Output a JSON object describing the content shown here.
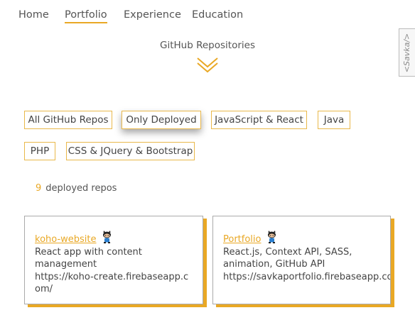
{
  "nav": {
    "items": [
      "Home",
      "Portfolio",
      "Experience",
      "Education"
    ],
    "active": "Portfolio"
  },
  "side_tab": {
    "label": "<Savka/>"
  },
  "section": {
    "title": "GitHub Repositories",
    "chevron_icon": "double-chevron-down-icon"
  },
  "filters": {
    "items": [
      "All GitHub Repos",
      "Only Deployed",
      "JavaScript & React",
      "Java",
      "PHP",
      "CSS & JQuery & Bootstrap"
    ],
    "active": "Only Deployed"
  },
  "repo_count": {
    "number": "9",
    "label": "deployed repos"
  },
  "repos": [
    {
      "name": "koho-website",
      "description": "React app with content management",
      "url": "https://koho-create.firebaseapp.com/",
      "icon": "octocat-icon"
    },
    {
      "name": "Portfolio",
      "description": "React.js, Context API, SASS, animation, GitHub API",
      "url": "https://savkaportfolio.firebaseapp.com",
      "icon": "octocat-icon"
    }
  ],
  "colors": {
    "accent": "#e9a825",
    "border": "#e9b84b",
    "text": "#444444"
  }
}
